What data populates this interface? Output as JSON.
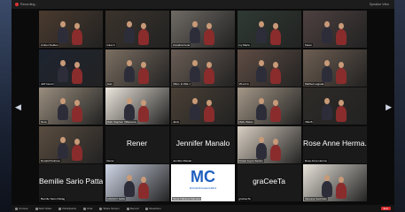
{
  "window": {
    "title": "Recording...",
    "right_label": "Speaker View"
  },
  "nav": {
    "prev_icon": "◀",
    "next_icon": "▶"
  },
  "rows": [
    [
      {
        "caption": "Amber Fieldes",
        "type": "video",
        "bg": "#4a3a2e"
      },
      {
        "caption": "Gina C",
        "type": "video",
        "bg": "#3b332c"
      },
      {
        "caption": "Annaliza Feria",
        "type": "video",
        "bg": "#6f6a64"
      },
      {
        "caption": "Ivy Maria",
        "type": "video",
        "bg": "#2f3a33"
      },
      {
        "caption": "Karen",
        "type": "video",
        "bg": "#4e4140"
      }
    ],
    [
      {
        "caption": "Jeff Ceroni",
        "type": "video",
        "bg": "#1e2430"
      },
      {
        "caption": "Jess",
        "type": "video",
        "bg": "#7c6f62"
      },
      {
        "caption": "Villa L & Villa J",
        "type": "video",
        "bg": "#6a5d55"
      },
      {
        "caption": "VILLA G",
        "type": "video",
        "bg": "#5f4d44"
      },
      {
        "caption": "Mathiel Lappata",
        "type": "video",
        "bg": "#6d5e52"
      }
    ],
    [
      {
        "caption": "Nora",
        "type": "video",
        "bg": "#9a8e7e"
      },
      {
        "caption": "Mark Stephen Villanueva",
        "type": "video",
        "bg": "#ece6dc"
      },
      {
        "caption": "Janis",
        "type": "video",
        "bg": "#4a4036"
      },
      {
        "caption": "Mark Weber",
        "type": "video",
        "bg": "#a49787"
      },
      {
        "caption": "Villa B",
        "type": "video",
        "bg": "#2e2b28"
      }
    ],
    [
      {
        "caption": "Donald Pedrosa",
        "type": "video",
        "bg": "#5a4d40"
      },
      {
        "caption": "Rener",
        "type": "name",
        "big": "Rener"
      },
      {
        "caption": "Jennifer Manalo",
        "type": "name",
        "big": "Jennifer Manalo"
      },
      {
        "caption": "Kristel Joyce Santos",
        "type": "video",
        "bg": "#d9cfc2"
      },
      {
        "caption": "Rose Anne Herma",
        "type": "name",
        "big": "Rose Anne Herma..."
      }
    ],
    [
      {
        "caption": "Bemilie Sario Pattag",
        "type": "name",
        "big": "Bemilie Sario Pattag"
      },
      {
        "caption": "GIANLIO Jarillo",
        "type": "video",
        "bg": "#cfd6e6"
      },
      {
        "caption": "Tarde Filipinas Manasis",
        "type": "logo",
        "logo": "MC",
        "logo_sub": "MANARINGHECHIBUI"
      },
      {
        "caption": "graCeeTa",
        "type": "name",
        "big": "graCeeTa"
      },
      {
        "caption": "Vanessa Sacristan",
        "type": "video",
        "bg": "#e8e3da"
      }
    ]
  ],
  "toolbar": {
    "items": [
      "Unmute",
      "Start Video",
      "Participants",
      "Chat",
      "Share Screen",
      "Record",
      "Reactions"
    ],
    "end_label": "End"
  },
  "colors": {
    "end": "#d52b2b",
    "logo_blue": "#1f5fbf"
  }
}
